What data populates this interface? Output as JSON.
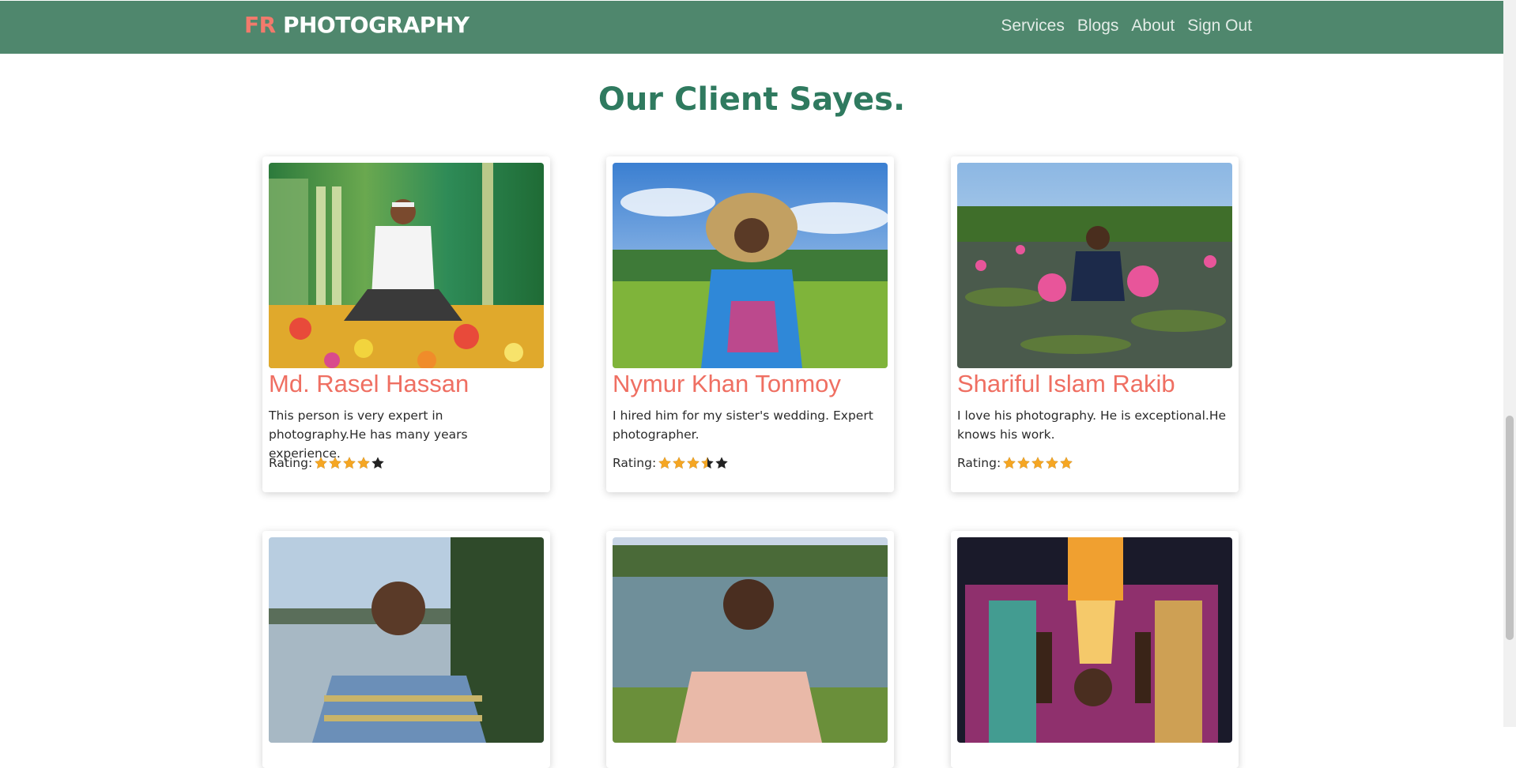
{
  "brand": {
    "accent": "FR",
    "name": "PHOTOGRAPHY"
  },
  "nav": [
    {
      "label": "Services"
    },
    {
      "label": "Blogs"
    },
    {
      "label": "About"
    },
    {
      "label": "Sign Out"
    }
  ],
  "section": {
    "title": "Our Client Sayes."
  },
  "rating_label": "Rating:",
  "clients": [
    {
      "name": "Md. Rasel Hassan",
      "text": "This person is very expert in photography.He has many years experience.",
      "rating": 4
    },
    {
      "name": "Nymur Khan Tonmoy",
      "text": "I hired him for my sister's wedding. Expert photographer.",
      "rating": 3.5
    },
    {
      "name": "Shariful Islam Rakib",
      "text": "I love his photography. He is exceptional.He knows his work.",
      "rating": 5
    },
    {
      "name": "",
      "text": "",
      "rating": null
    },
    {
      "name": "",
      "text": "",
      "rating": null
    },
    {
      "name": "",
      "text": "",
      "rating": null
    }
  ],
  "colors": {
    "navbar": "#4f876d",
    "brand_accent": "#f27a6c",
    "title": "#2f7a5f",
    "client_name": "#ef6f62",
    "star_filled": "#f5a623",
    "star_empty": "#222222"
  }
}
